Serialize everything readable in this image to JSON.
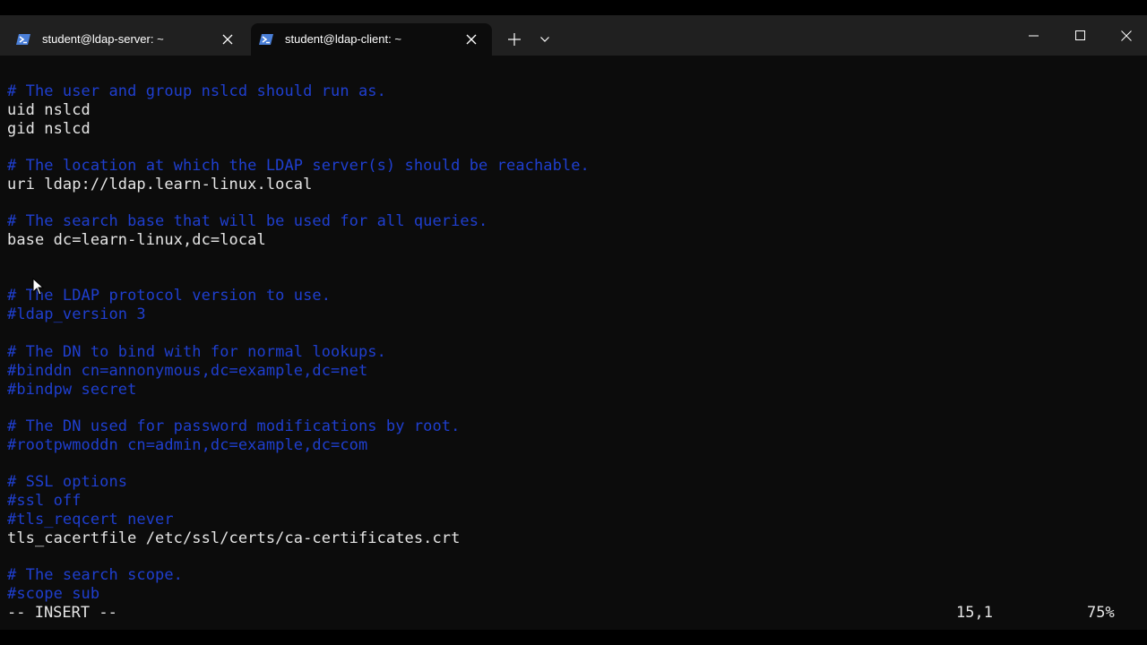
{
  "window": {
    "tabs": [
      {
        "label": "student@ldap-server: ~",
        "icon": "powershell-icon",
        "active": false
      },
      {
        "label": "student@ldap-client: ~",
        "icon": "powershell-icon",
        "active": true
      }
    ],
    "new_tab_label": "+",
    "controls": [
      "minimize-icon",
      "maximize-icon",
      "close-icon"
    ]
  },
  "editor": {
    "lines": [
      "# The user and group nslcd should run as.",
      "uid nslcd",
      "gid nslcd",
      "",
      "# The location at which the LDAP server(s) should be reachable.",
      "uri ldap://ldap.learn-linux.local",
      "",
      "# The search base that will be used for all queries.",
      "base dc=learn-linux,dc=local",
      "",
      "",
      "# The LDAP protocol version to use.",
      "#ldap_version 3",
      "",
      "# The DN to bind with for normal lookups.",
      "#binddn cn=annonymous,dc=example,dc=net",
      "#bindpw secret",
      "",
      "# The DN used for password modifications by root.",
      "#rootpwmoddn cn=admin,dc=example,dc=com",
      "",
      "# SSL options",
      "#ssl off",
      "#tls_reqcert never",
      "tls_cacertfile /etc/ssl/certs/ca-certificates.crt",
      "",
      "# The search scope.",
      "#scope sub"
    ],
    "status": {
      "mode": "-- INSERT --",
      "position": "15,1",
      "percent": "75%"
    }
  },
  "colors": {
    "comment": "#1f3fd0",
    "text": "#e6e6e6",
    "background": "#0c0c0c",
    "titlebar": "#202020"
  }
}
